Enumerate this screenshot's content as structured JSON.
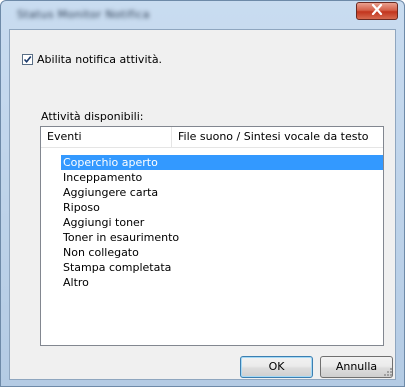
{
  "window": {
    "title": "Status Monitor Notifica",
    "close_icon": "close-icon"
  },
  "settings": {
    "enable_label": "Abilita notifica attività.",
    "enable_checked": true
  },
  "activities": {
    "label": "Attività disponibili:",
    "columns": [
      "Eventi",
      "File suono / Sintesi vocale da testo"
    ],
    "items": [
      "Coperchio aperto",
      "Inceppamento",
      "Aggiungere carta",
      "Riposo",
      "Aggiungi toner",
      "Toner in esaurimento",
      "Non collegato",
      "Stampa completata",
      "Altro"
    ],
    "selected_index": 0
  },
  "buttons": {
    "ok": "OK",
    "cancel": "Annulla"
  },
  "colors": {
    "selection": "#3399ff",
    "close_button": "#c2351e"
  }
}
